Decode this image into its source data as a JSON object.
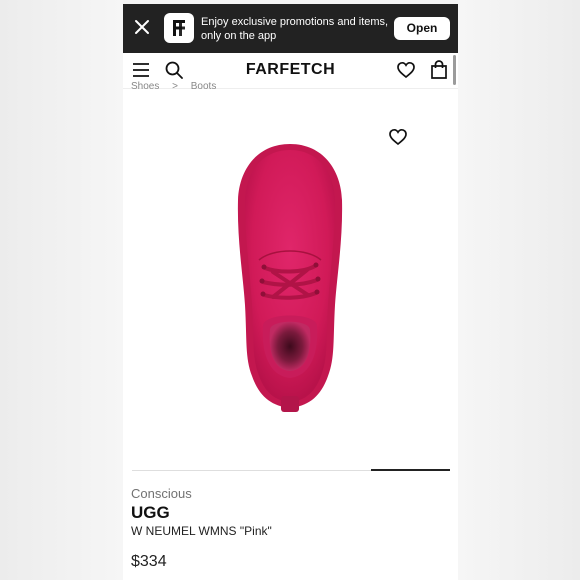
{
  "banner": {
    "message": "Enjoy exclusive promotions and items, only on the app",
    "open_label": "Open",
    "icons": [
      "close-icon",
      "farfetch-app-logo"
    ]
  },
  "header": {
    "brand": "FARFETCH",
    "icons": [
      "menu-icon",
      "search-icon",
      "wishlist-icon",
      "bag-icon"
    ]
  },
  "breadcrumbs": [
    "Shoes",
    ">",
    "Boots"
  ],
  "product": {
    "image_desc_color": "#d81b5b",
    "gallery_index": 4,
    "gallery_count": 4,
    "tag": "Conscious",
    "brand": "UGG",
    "name": "W NEUMEL WMNS \"Pink\"",
    "price": "$334"
  },
  "colors": {
    "banner_bg": "#222222",
    "boot_pink": "#d81b5b",
    "text_dark": "#111111",
    "text_muted": "#727272"
  }
}
